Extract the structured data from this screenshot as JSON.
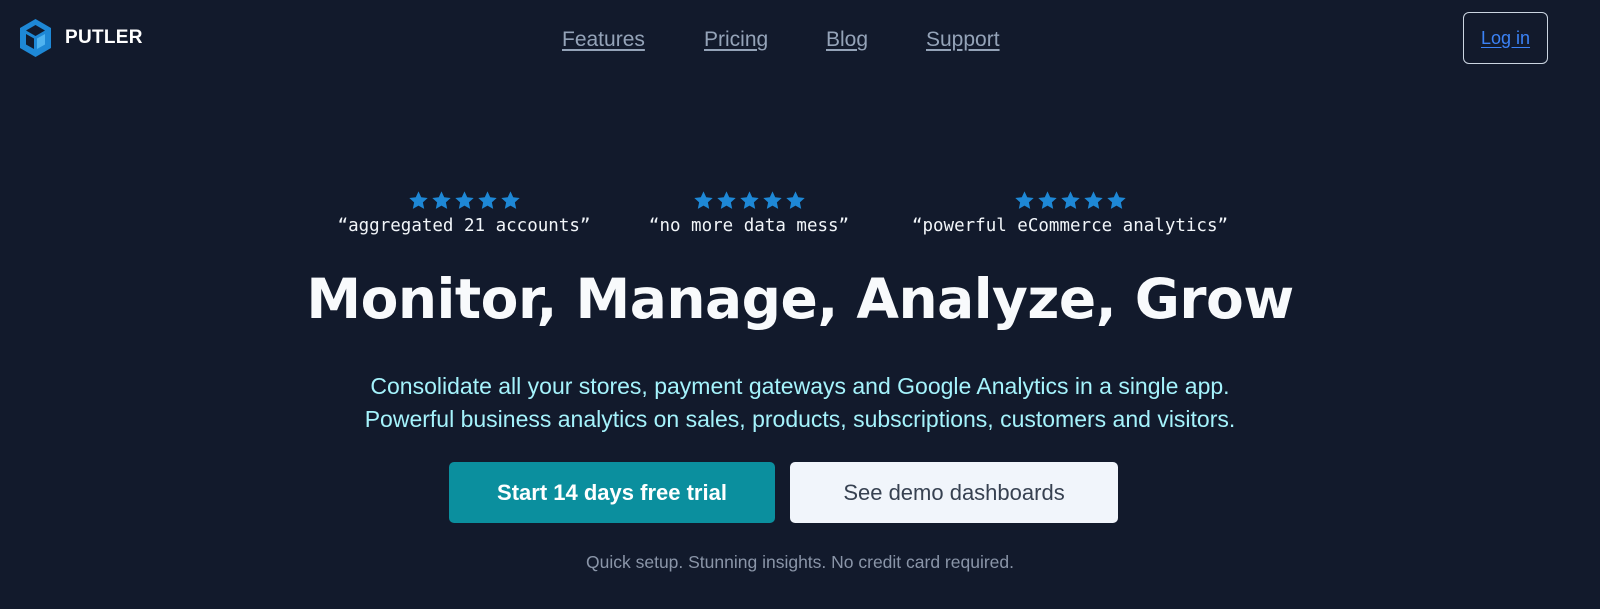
{
  "brand": {
    "name": "PUTLER",
    "logo_icon": "cube-logo-icon",
    "accent": "#1e88d6"
  },
  "nav": {
    "features": "Features",
    "pricing": "Pricing",
    "blog": "Blog",
    "support": "Support",
    "login": "Log in"
  },
  "reviews": [
    {
      "rating": 5,
      "quote": "“aggregated 21 accounts”"
    },
    {
      "rating": 5,
      "quote": "“no more data mess”"
    },
    {
      "rating": 5,
      "quote": "“powerful eCommerce analytics”"
    }
  ],
  "hero": {
    "headline": "Monitor, Manage, Analyze, Grow",
    "subline_1": "Consolidate all your stores, payment gateways and Google Analytics in a single app.",
    "subline_2": "Powerful business analytics on sales, products, subscriptions, customers and visitors."
  },
  "cta": {
    "primary": "Start 14 days free trial",
    "secondary": "See demo dashboards",
    "note": "Quick setup. Stunning insights. No credit card required."
  },
  "colors": {
    "background": "#121a2c",
    "star": "#1e88d6",
    "primary_button": "#0b8f9e",
    "subtitle": "#a5f3fc"
  }
}
